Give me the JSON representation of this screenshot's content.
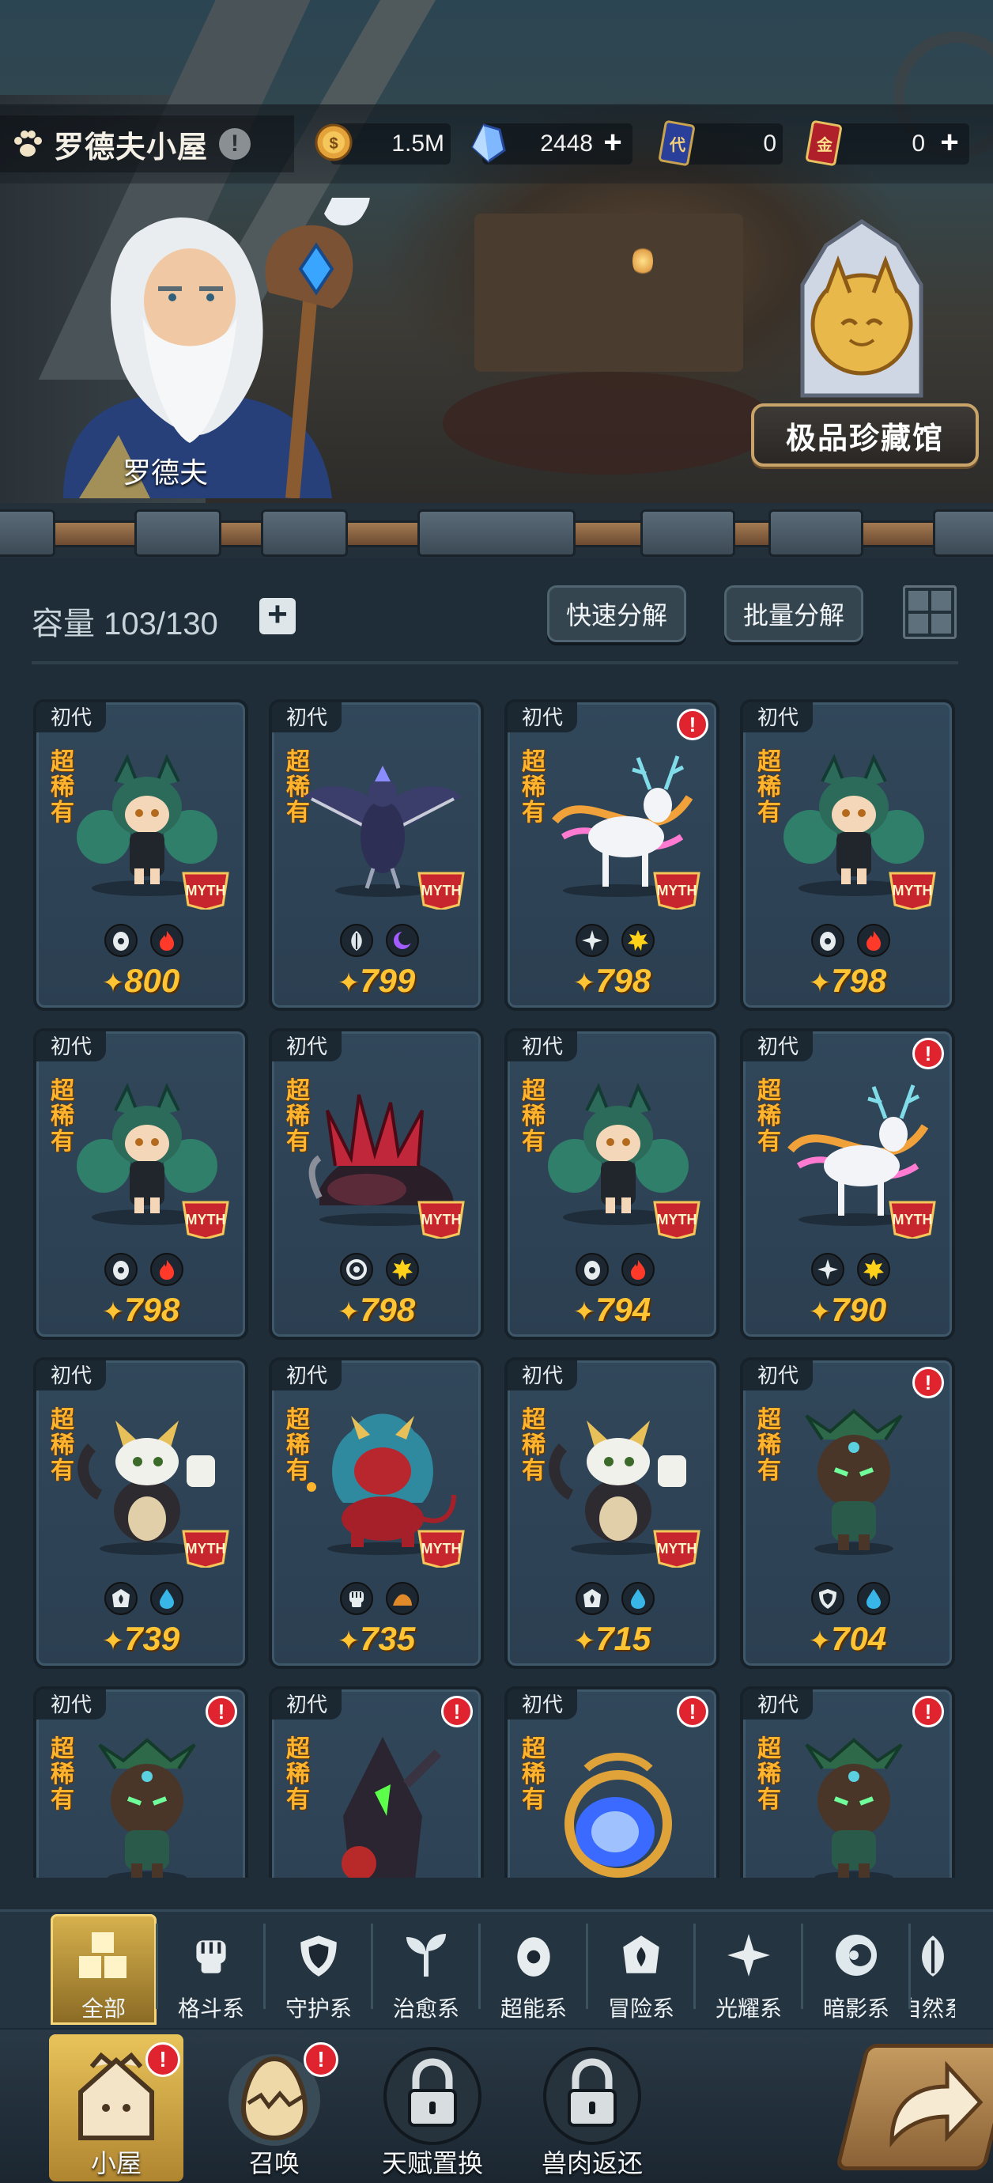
{
  "header": {
    "title": "罗德夫小屋",
    "npc_name": "罗德夫",
    "gallery_button": "极品珍藏馆"
  },
  "resources": [
    {
      "icon": "gold-coin-icon",
      "value": "1.5M",
      "has_plus": false
    },
    {
      "icon": "crystal-icon",
      "value": "2448",
      "has_plus": true
    },
    {
      "icon": "generation-ticket-icon",
      "value": "0",
      "has_plus": false
    },
    {
      "icon": "gold-ticket-icon",
      "value": "0",
      "has_plus": true
    }
  ],
  "inventory": {
    "capacity_label": "容量 103/130",
    "quick_decompose": "快速分解",
    "batch_decompose": "批量分解"
  },
  "cards": [
    {
      "gen": "初代",
      "rarity": "超稀有",
      "score": "800",
      "alert": false,
      "myth": true,
      "creature": "green-fox",
      "elements": [
        "psychic-icon",
        "fire-icon"
      ]
    },
    {
      "gen": "初代",
      "rarity": "超稀有",
      "score": "799",
      "alert": false,
      "myth": true,
      "creature": "dark-eagle",
      "elements": [
        "leaf-icon",
        "moon-icon"
      ]
    },
    {
      "gen": "初代",
      "rarity": "超稀有",
      "score": "798",
      "alert": true,
      "myth": true,
      "creature": "spirit-deer",
      "elements": [
        "star-cross-icon",
        "sun-icon"
      ]
    },
    {
      "gen": "初代",
      "rarity": "超稀有",
      "score": "798",
      "alert": false,
      "myth": true,
      "creature": "green-fox",
      "elements": [
        "psychic-icon",
        "fire-icon"
      ]
    },
    {
      "gen": "初代",
      "rarity": "超稀有",
      "score": "798",
      "alert": false,
      "myth": true,
      "creature": "green-fox",
      "elements": [
        "psychic-icon",
        "fire-icon"
      ]
    },
    {
      "gen": "初代",
      "rarity": "超稀有",
      "score": "798",
      "alert": false,
      "myth": true,
      "creature": "crimson-dragon",
      "elements": [
        "vortex-icon",
        "sun-icon"
      ]
    },
    {
      "gen": "初代",
      "rarity": "超稀有",
      "score": "794",
      "alert": false,
      "myth": true,
      "creature": "green-fox",
      "elements": [
        "psychic-icon",
        "fire-icon"
      ]
    },
    {
      "gen": "初代",
      "rarity": "超稀有",
      "score": "790",
      "alert": true,
      "myth": true,
      "creature": "spirit-deer",
      "elements": [
        "star-cross-icon",
        "sun-icon"
      ]
    },
    {
      "gen": "初代",
      "rarity": "超稀有",
      "score": "739",
      "alert": false,
      "myth": true,
      "creature": "bone-dragon",
      "elements": [
        "adventure-icon",
        "water-icon"
      ]
    },
    {
      "gen": "初代",
      "rarity": "超稀有",
      "score": "735",
      "alert": false,
      "myth": true,
      "creature": "red-lion",
      "elements": [
        "fist-icon",
        "earth-icon"
      ]
    },
    {
      "gen": "初代",
      "rarity": "超稀有",
      "score": "715",
      "alert": false,
      "myth": true,
      "creature": "bone-dragon",
      "elements": [
        "adventure-icon",
        "water-icon"
      ]
    },
    {
      "gen": "初代",
      "rarity": "超稀有",
      "score": "704",
      "alert": true,
      "myth": false,
      "creature": "treant",
      "elements": [
        "shield-icon",
        "water-icon"
      ]
    },
    {
      "gen": "初代",
      "rarity": "超稀有",
      "score": "",
      "alert": true,
      "myth": false,
      "creature": "treant",
      "elements": []
    },
    {
      "gen": "初代",
      "rarity": "超稀有",
      "score": "",
      "alert": true,
      "myth": false,
      "creature": "demon",
      "elements": []
    },
    {
      "gen": "初代",
      "rarity": "超稀有",
      "score": "",
      "alert": true,
      "myth": false,
      "creature": "blue-wisp",
      "elements": []
    },
    {
      "gen": "初代",
      "rarity": "超稀有",
      "score": "",
      "alert": true,
      "myth": false,
      "creature": "treant",
      "elements": []
    }
  ],
  "myth_badge": "神话",
  "categories": [
    {
      "label": "全部",
      "icon": "blocks-icon",
      "active": true
    },
    {
      "label": "格斗系",
      "icon": "fist-icon",
      "active": false
    },
    {
      "label": "守护系",
      "icon": "shield-icon",
      "active": false
    },
    {
      "label": "治愈系",
      "icon": "sprout-icon",
      "active": false
    },
    {
      "label": "超能系",
      "icon": "psychic-icon",
      "active": false
    },
    {
      "label": "冒险系",
      "icon": "adventure-icon",
      "active": false
    },
    {
      "label": "光耀系",
      "icon": "star-cross-icon",
      "active": false
    },
    {
      "label": "暗影系",
      "icon": "shadow-icon",
      "active": false
    },
    {
      "label": "自然系",
      "icon": "leaf-icon",
      "active": false
    }
  ],
  "nav": [
    {
      "label": "小屋",
      "icon": "house-icon",
      "active": true,
      "badge": true,
      "locked": false
    },
    {
      "label": "召唤",
      "icon": "egg-icon",
      "active": false,
      "badge": true,
      "locked": false
    },
    {
      "label": "天赋置换",
      "icon": "lock-icon",
      "active": false,
      "badge": false,
      "locked": true
    },
    {
      "label": "兽肉返还",
      "icon": "lock-icon",
      "active": false,
      "badge": false,
      "locked": true
    }
  ],
  "colors": {
    "accent_gold": "#ffc434",
    "rarity_orange": "#ffb42e",
    "alert_red": "#e0242f",
    "panel_bg": "#1f2d38"
  }
}
